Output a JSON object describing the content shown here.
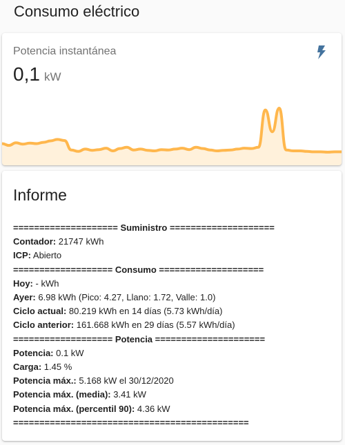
{
  "page": {
    "title": "Consumo eléctrico"
  },
  "sensor_card": {
    "name": "Potencia instantánea",
    "value": "0,1",
    "unit": "kW",
    "icon": "lightning-bolt-icon",
    "accent_color": "#44739e",
    "graph_color": "#ffb74d",
    "graph_values": [
      0.55,
      0.45,
      0.6,
      0.52,
      0.58,
      0.55,
      0.62,
      0.7,
      0.78,
      0.72,
      0.2,
      0.12,
      0.25,
      0.18,
      0.22,
      0.3,
      0.15,
      0.28,
      0.35,
      0.2,
      0.25,
      0.18,
      0.15,
      0.22,
      0.2,
      0.25,
      0.3,
      0.22,
      0.35,
      0.28,
      0.2,
      0.15,
      0.18,
      0.2,
      0.25,
      0.3,
      0.28,
      0.35,
      2.4,
      1.2,
      2.5,
      0.2,
      0.15,
      0.15,
      0.12,
      0.1,
      0.1,
      0.08,
      0.1,
      0.1
    ]
  },
  "report_card": {
    "title": "Informe",
    "lines": [
      {
        "bold": "==================== Suministro ====================",
        "text": ""
      },
      {
        "bold": "Contador:",
        "text": " 21747 kWh"
      },
      {
        "bold": "ICP:",
        "text": " Abierto"
      },
      {
        "bold": "=================== Consumo ====================",
        "text": ""
      },
      {
        "bold": "Hoy:",
        "text": " - kWh"
      },
      {
        "bold": "Ayer:",
        "text": " 6.98 kWh (Pico: 4.27, Llano: 1.72, Valle: 1.0)"
      },
      {
        "bold": "Ciclo actual:",
        "text": " 80.219 kWh en 14 días (5.73 kWh/día)"
      },
      {
        "bold": "Ciclo anterior:",
        "text": " 161.668 kWh en 29 días (5.57 kWh/día)"
      },
      {
        "bold": "=================== Potencia =====================",
        "text": ""
      },
      {
        "bold": "Potencia:",
        "text": " 0.1 kW"
      },
      {
        "bold": "Carga:",
        "text": " 1.45 %"
      },
      {
        "bold": "Potencia máx.:",
        "text": " 5.168 kW el 30/12/2020"
      },
      {
        "bold": "Potencia máx. (media):",
        "text": " 3.41 kW"
      },
      {
        "bold": "Potencia máx. (percentil 90):",
        "text": " 4.36 kW"
      },
      {
        "bold": "=============================================",
        "text": ""
      }
    ]
  }
}
